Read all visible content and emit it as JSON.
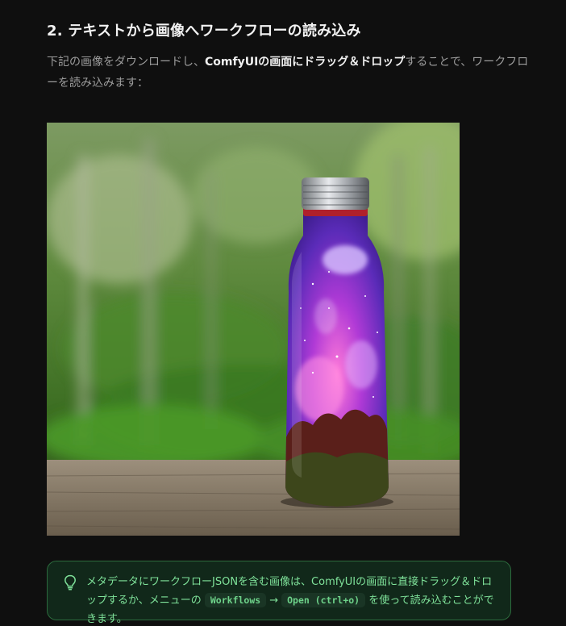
{
  "section": {
    "heading": "2. テキストから画像へワークフローの読み込み"
  },
  "intro": {
    "text_before": "下記の画像をダウンロードし、",
    "bold_1": "ComfyUIの画面にドラッグ＆ドロップ",
    "text_after": "することで、ワークフローを読み込みます："
  },
  "image": {
    "subject": "galaxy-bottle-on-wooden-table"
  },
  "tip": {
    "icon": "lightbulb-icon",
    "text_before": "メタデータにワークフローJSONを含む画像は、ComfyUIの画面に直接ドラッグ＆ドロップするか、メニューの ",
    "code_workflows": "Workflows",
    "arrow": "→",
    "code_open": "Open (ctrl+o)",
    "text_after": " を使って読み込むことができます。",
    "colors": {
      "border": "#2c6b3d",
      "background": "#11281a",
      "text": "#7fe29a"
    }
  },
  "colors": {
    "page_background": "#0f0f0f",
    "heading": "#f2f2f2",
    "body_text": "#9c9c9c",
    "bold_text": "#f0f0f0"
  }
}
